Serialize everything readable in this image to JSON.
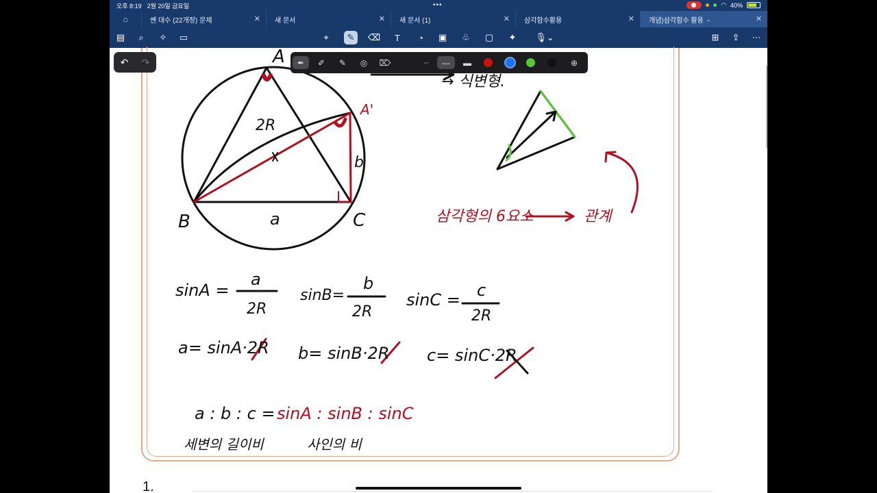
{
  "status": {
    "time": "오후 8:19",
    "date": "2월 20일 금요일",
    "battery": "40%"
  },
  "tabs": [
    {
      "label": "쎈 대수 (22개정) 문제"
    },
    {
      "label": "새 문서"
    },
    {
      "label": "새 문서 (1)"
    },
    {
      "label": "삼각함수활용"
    },
    {
      "label": "개념)삼각함수 활용"
    }
  ],
  "toolbar": {
    "left_tools": [
      "sidebar-icon",
      "search-icon",
      "ai-sparkle-icon",
      "clipboard-icon"
    ],
    "center_tools": [
      "lasso-icon",
      "pen-icon",
      "eraser-icon",
      "textbox-icon",
      "shapes-icon",
      "image-icon",
      "elements-icon",
      "sticky-note-icon",
      "laser-icon",
      "microphone-icon"
    ],
    "right_tools": [
      "add-page-icon",
      "share-icon",
      "more-icon"
    ]
  },
  "pen_tray": {
    "tools": [
      "fountain-pen-icon",
      "highlighter-icon",
      "pencil-icon",
      "lasso-ring-icon",
      "shape-eraser-icon"
    ],
    "widths": [
      "dotted",
      "thin",
      "thick"
    ],
    "colors": [
      "#cc1111",
      "#1a73e8",
      "#5ac53a",
      "#111111"
    ]
  },
  "notes": {
    "vertex_A": "A",
    "vertex_A_prime": "A'",
    "vertex_B": "B",
    "vertex_C": "C",
    "side_a": "a",
    "side_b": "b",
    "diameter": "2R",
    "header_fragment": "→ 식변형.",
    "sin_A": "sinA =",
    "sin_B": "sinB=",
    "sin_C": "sinC =",
    "a_over": "a",
    "b_over": "b",
    "c_over": "c",
    "denominator": "2R",
    "a_eq": "a= sinA·2R",
    "b_eq": "b= sinB·2R",
    "c_eq": "c= sinC·2R",
    "ratio_left": "a : b : c =",
    "ratio_right": "sinA : sinB : sinC",
    "ratio_caption_left": "세변의 길이비",
    "ratio_caption_right": "사인의 비",
    "triangle_6": "삼각형의 6요소",
    "relation": "관계",
    "next_problem": "1."
  }
}
